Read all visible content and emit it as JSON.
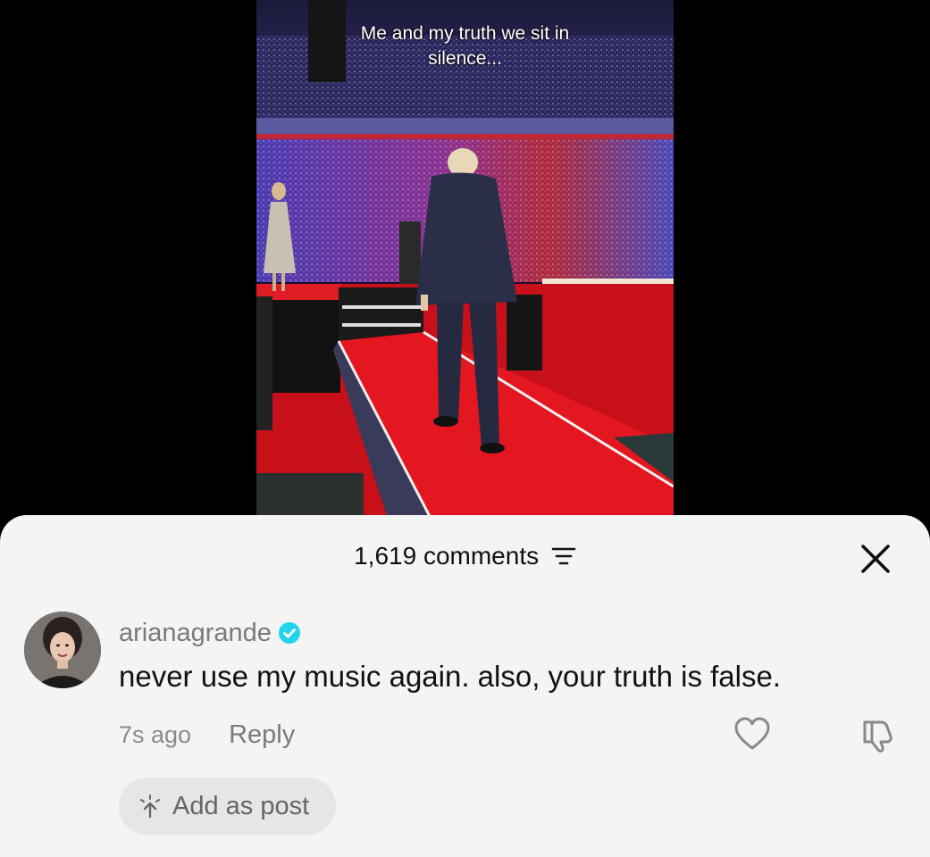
{
  "video": {
    "caption_line1": "Me and my truth we sit in",
    "caption_line2": "silence..."
  },
  "comments_sheet": {
    "count_label": "1,619 comments",
    "filter_icon": "filter-lines-icon",
    "close_icon": "close-x-icon"
  },
  "comment": {
    "username": "arianagrande",
    "verified": true,
    "text": "never use my music again. also, your truth is false.",
    "timestamp": "7s ago",
    "reply_label": "Reply",
    "like_icon": "heart-outline-icon",
    "dislike_icon": "thumbs-down-icon"
  },
  "add_post": {
    "label": "Add as post",
    "icon": "sparkle-arrow-icon"
  },
  "colors": {
    "sheet_bg": "#f4f4f4",
    "verified_blue": "#20d5ec",
    "stage_red": "#d8121a",
    "text_dark": "#111111",
    "text_grey": "#7a7a7a"
  }
}
